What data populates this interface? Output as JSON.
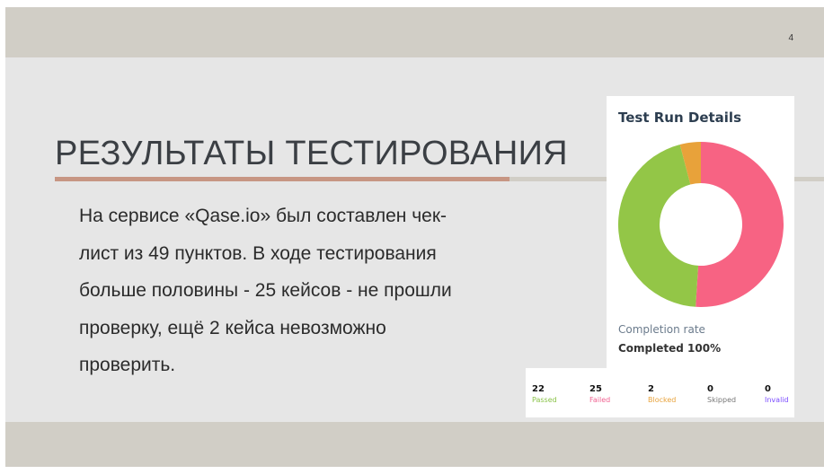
{
  "slide": {
    "page_number": "4",
    "title": "РЕЗУЛЬТАТЫ ТЕСТИРОВАНИЯ",
    "body_lines": [
      "На сервисе «Qase.io» был составлен чек-",
      "лист из 49 пунктов. В ходе тестирования",
      "больше половины - 25 кейсов - не прошли",
      "проверку, ещё 2 кейса невозможно",
      "проверить."
    ]
  },
  "report": {
    "title": "Test Run Details",
    "completion_label": "Completion rate",
    "completion_value": "Completed 100%",
    "stats": [
      {
        "value": "22",
        "label": "Passed",
        "color": "#8bc34a"
      },
      {
        "value": "25",
        "label": "Failed",
        "color": "#f06292"
      },
      {
        "value": "2",
        "label": "Blocked",
        "color": "#e8a33c"
      },
      {
        "value": "0",
        "label": "Skipped",
        "color": "#777777"
      },
      {
        "value": "0",
        "label": "Invalid",
        "color": "#7c4dff"
      }
    ]
  },
  "chart_data": {
    "type": "pie",
    "categories": [
      "Failed",
      "Passed",
      "Blocked"
    ],
    "values": [
      25,
      22,
      2
    ],
    "colors": [
      "#f76383",
      "#93c647",
      "#e8a23a"
    ]
  }
}
